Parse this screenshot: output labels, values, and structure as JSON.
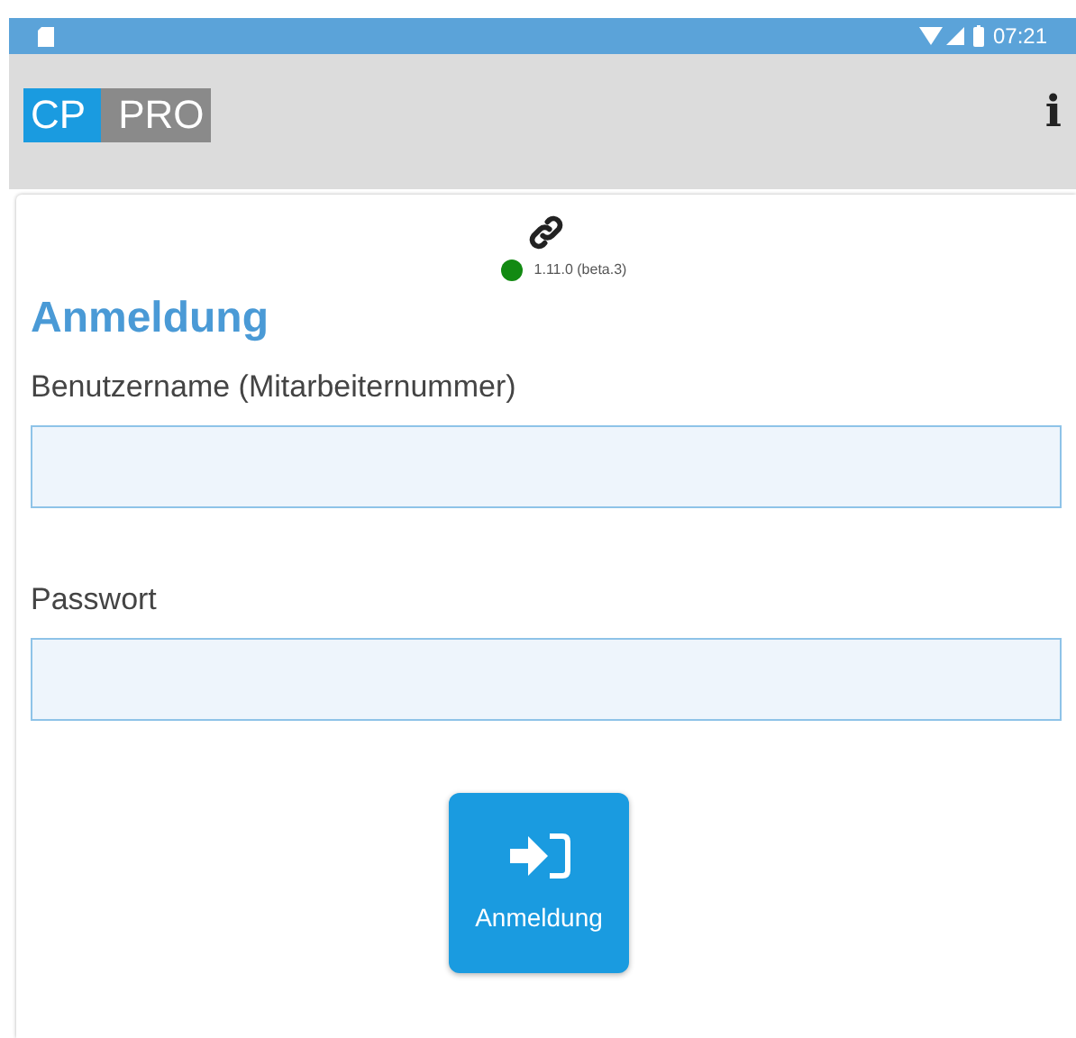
{
  "status_bar": {
    "time": "07:21"
  },
  "app_bar": {
    "logo": [
      "CP",
      "PRO"
    ],
    "info_icon": "i"
  },
  "connection": {
    "color": "#128a12",
    "version": "1.11.0 (beta.3)"
  },
  "title": "Anmeldung",
  "fields": [
    {
      "label": "Benutzername (Mitarbeiternummer)"
    },
    {
      "label": "Passwort"
    }
  ],
  "login_button": {
    "label": "Anmeldung"
  }
}
